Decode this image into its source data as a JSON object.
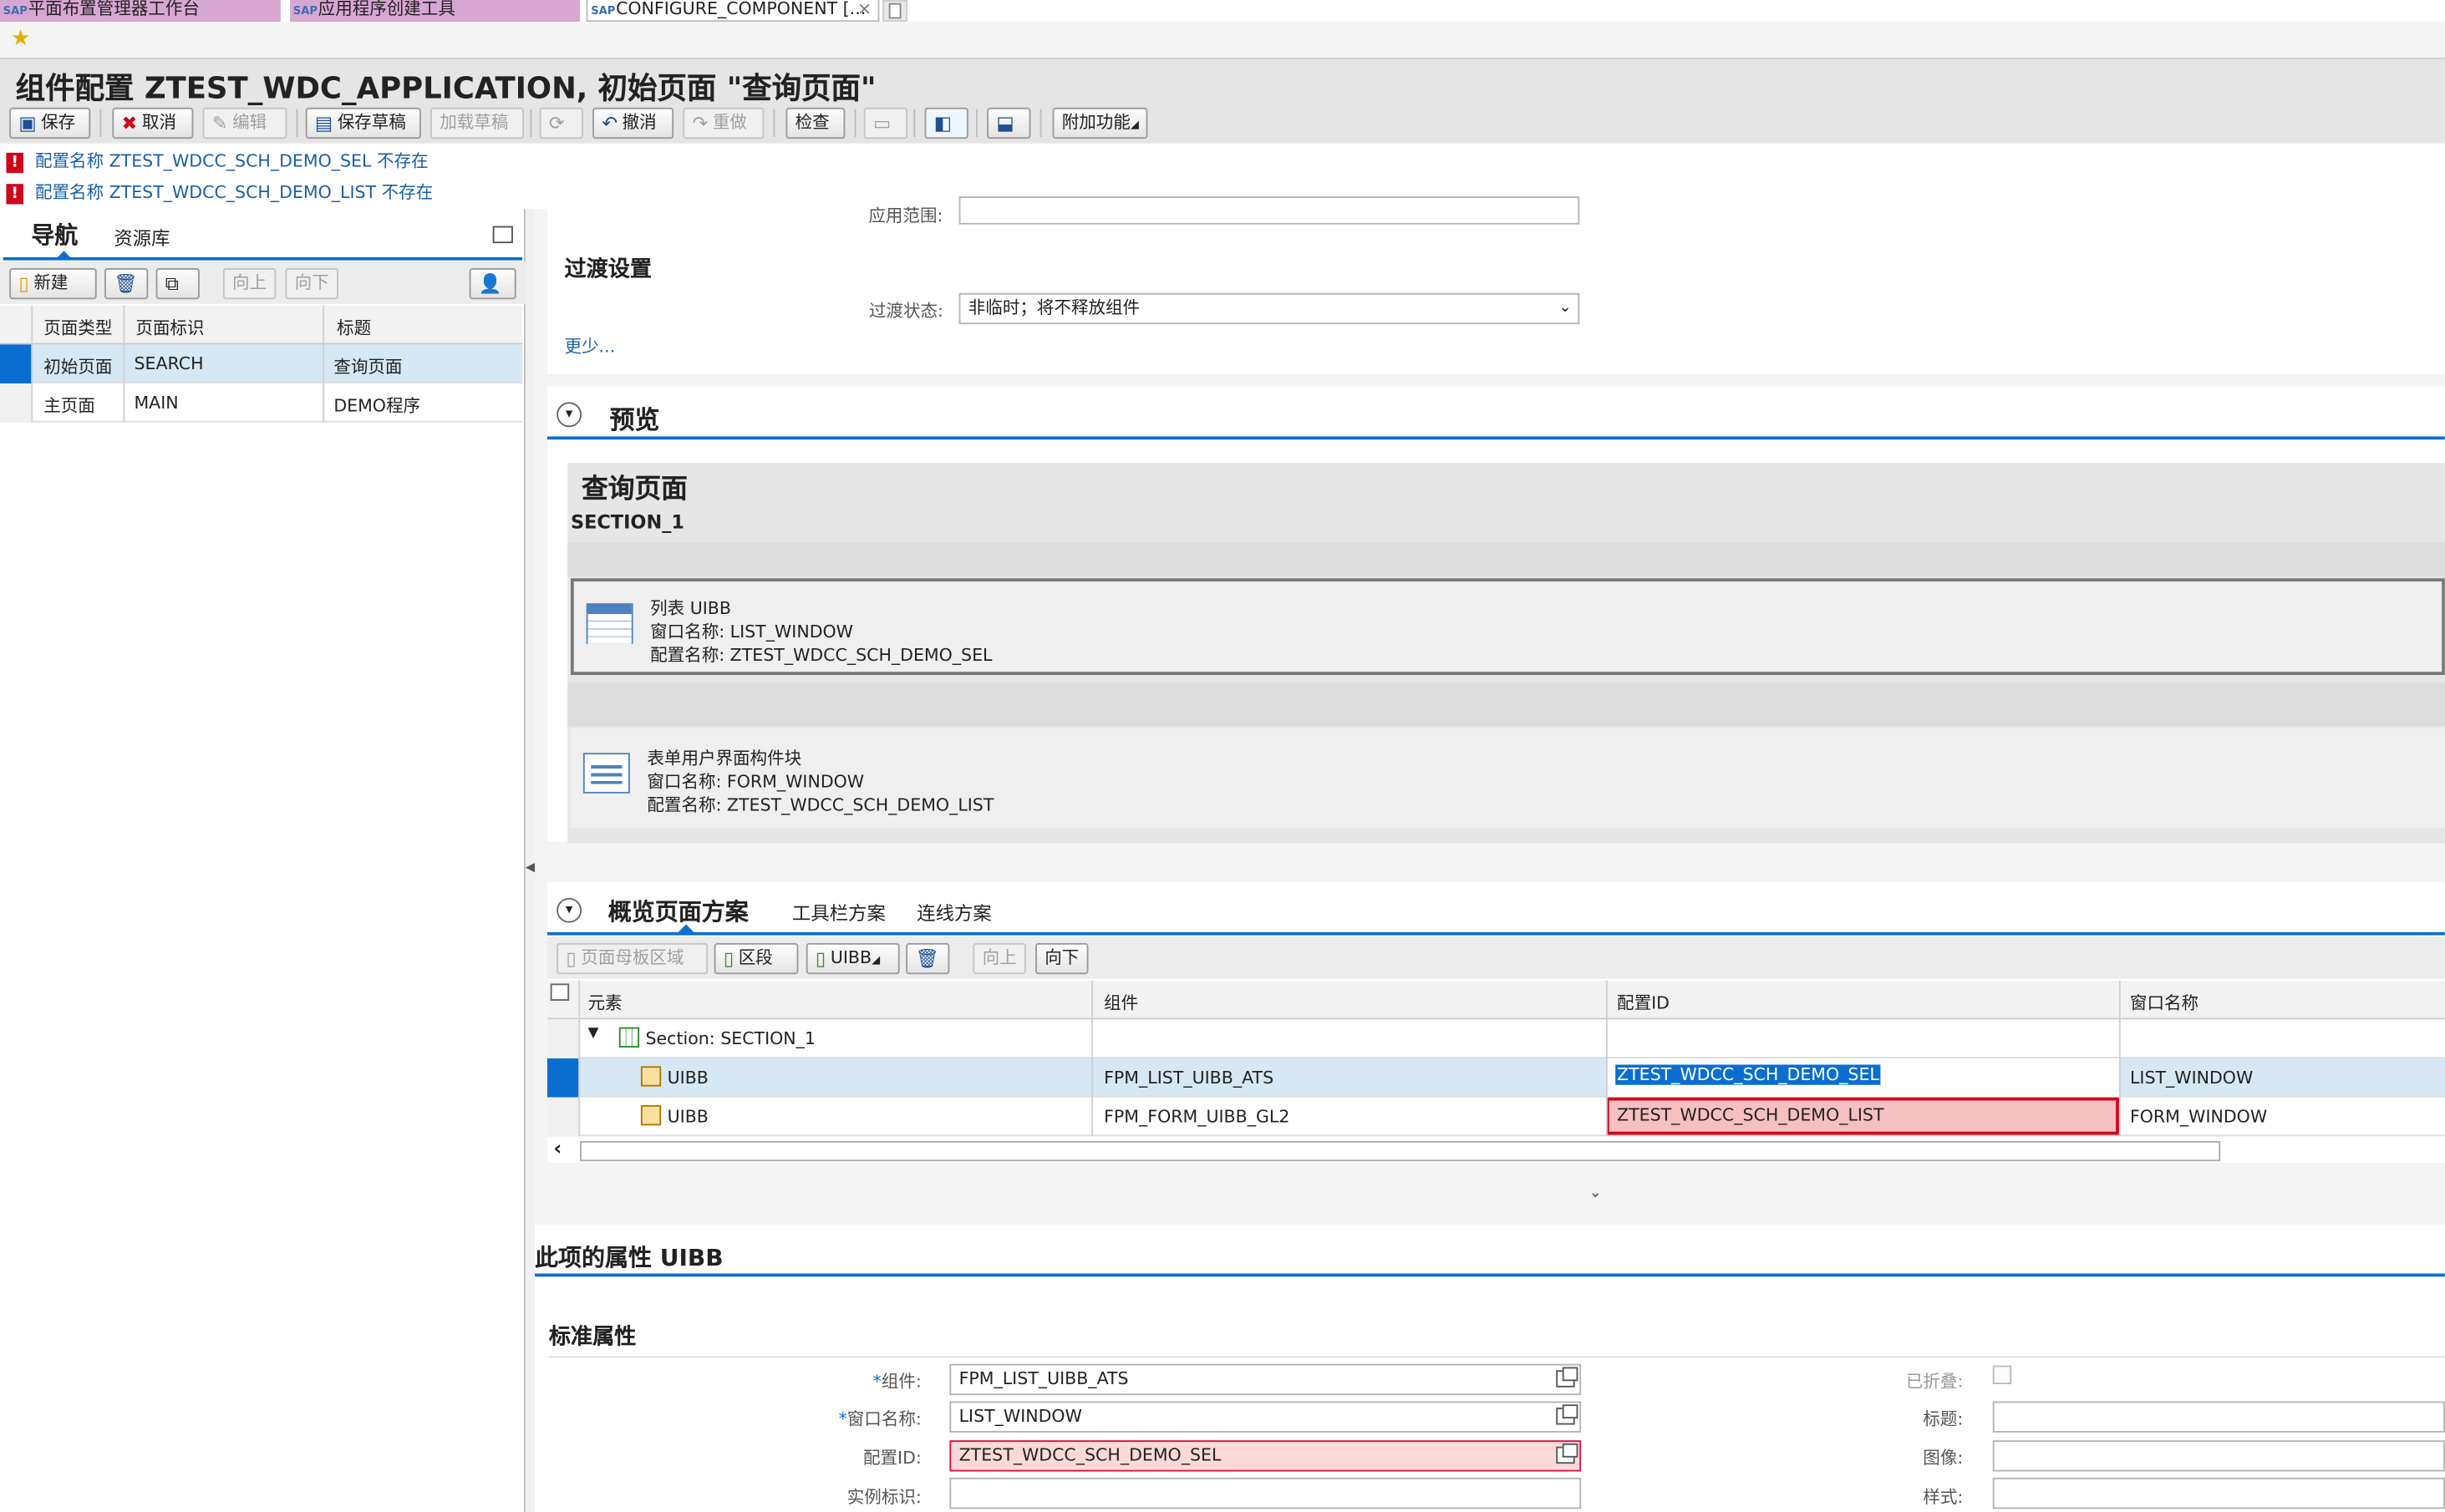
{
  "tabs": [
    "平面布置管理器工作台",
    "应用程序创建工具",
    "CONFIGURE_COMPONENT [..."
  ],
  "page_title": "组件配置 ZTEST_WDC_APPLICATION, 初始页面 \"查询页面\"",
  "toolbar": {
    "save": "保存",
    "cancel": "取消",
    "edit": "编辑",
    "save_draft": "保存草稿",
    "load_draft": "加载草稿",
    "undo": "撤消",
    "redo": "重做",
    "check": "检查",
    "extra": "附加功能"
  },
  "messages": [
    "配置名称 ZTEST_WDCC_SCH_DEMO_SEL 不存在",
    "配置名称 ZTEST_WDCC_SCH_DEMO_LIST 不存在"
  ],
  "left": {
    "tabs": [
      "导航",
      "资源库"
    ],
    "buttons": {
      "new": "新建",
      "up": "向上",
      "down": "向下"
    },
    "columns": [
      "页面类型",
      "页面标识",
      "标题"
    ],
    "rows": [
      [
        "初始页面",
        "SEARCH",
        "查询页面"
      ],
      [
        "主页面",
        "MAIN",
        "DEMO程序"
      ]
    ]
  },
  "top_partial_label": "应用范围:",
  "transition": {
    "heading": "过渡设置",
    "label": "过渡状态:",
    "value": "非临时；将不释放组件",
    "less": "更少..."
  },
  "preview": {
    "heading": "预览",
    "page_title": "查询页面",
    "section": "SECTION_1",
    "uibbs": [
      {
        "line1": "列表 UIBB",
        "line2": "窗口名称: LIST_WINDOW",
        "line3": "配置名称: ZTEST_WDCC_SCH_DEMO_SEL"
      },
      {
        "line1": "表单用户界面构件块",
        "line2": "窗口名称: FORM_WINDOW",
        "line3": "配置名称: ZTEST_WDCC_SCH_DEMO_LIST"
      }
    ]
  },
  "overview": {
    "tabs": [
      "概览页面方案",
      "工具栏方案",
      "连线方案"
    ],
    "buttons": {
      "master": "页面母板区域",
      "section": "区段",
      "uibb": "UIBB",
      "up": "向上",
      "down": "向下"
    },
    "columns": [
      "元素",
      "组件",
      "配置ID",
      "窗口名称"
    ],
    "section_row": "Section: SECTION_1",
    "rows": [
      [
        "UIBB",
        "FPM_LIST_UIBB_ATS",
        "ZTEST_WDCC_SCH_DEMO_SEL",
        "LIST_WINDOW"
      ],
      [
        "UIBB",
        "FPM_FORM_UIBB_GL2",
        "ZTEST_WDCC_SCH_DEMO_LIST",
        "FORM_WINDOW"
      ]
    ]
  },
  "props": {
    "heading": "此项的属性 UIBB",
    "sub": "标准属性",
    "left_labels": [
      "组件:",
      "窗口名称:",
      "配置ID:",
      "实例标识:"
    ],
    "left_values": [
      "FPM_LIST_UIBB_ATS",
      "LIST_WINDOW",
      "ZTEST_WDCC_SCH_DEMO_SEL",
      ""
    ],
    "right_labels": [
      "已折叠:",
      "标题:",
      "图像:",
      "样式:"
    ]
  },
  "colors": {
    "accent": "#0a6ed1",
    "error": "#d0021b",
    "selected": "#d5e8f4",
    "purple_tab": "#d7a7d3"
  }
}
